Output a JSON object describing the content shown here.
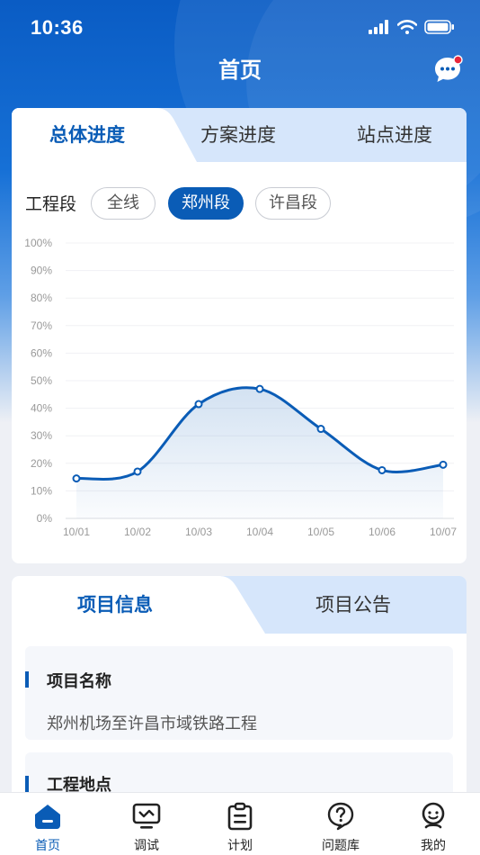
{
  "status_bar": {
    "time": "10:36"
  },
  "nav": {
    "title": "首页",
    "message_icon": "chat-bubble-icon"
  },
  "progress_tabs": [
    {
      "label": "总体进度",
      "active": true
    },
    {
      "label": "方案进度",
      "active": false
    },
    {
      "label": "站点进度",
      "active": false
    }
  ],
  "segment_filter": {
    "label": "工程段",
    "options": [
      {
        "label": "全线",
        "active": false
      },
      {
        "label": "郑州段",
        "active": true
      },
      {
        "label": "许昌段",
        "active": false
      }
    ]
  },
  "chart_data": {
    "type": "line",
    "x": [
      "10/01",
      "10/02",
      "10/03",
      "10/04",
      "10/05",
      "10/06",
      "10/07"
    ],
    "values": [
      14.5,
      17,
      41.5,
      47,
      32.5,
      17.5,
      19.5
    ],
    "yticks": [
      "0%",
      "10%",
      "20%",
      "30%",
      "40%",
      "50%",
      "60%",
      "70%",
      "80%",
      "90%",
      "100%"
    ],
    "ylim": [
      0,
      100
    ],
    "smooth": true,
    "area_fill": true,
    "line_color": "#0a5cb6"
  },
  "info_tabs": [
    {
      "label": "项目信息",
      "active": true
    },
    {
      "label": "项目公告",
      "active": false
    }
  ],
  "project_info": [
    {
      "title": "项目名称",
      "value": "郑州机场至许昌市域铁路工程"
    },
    {
      "title": "工程地点",
      "value": ""
    }
  ],
  "tabbar": [
    {
      "label": "首页",
      "icon": "home-icon",
      "active": true
    },
    {
      "label": "调试",
      "icon": "monitor-icon",
      "active": false
    },
    {
      "label": "计划",
      "icon": "clipboard-icon",
      "active": false
    },
    {
      "label": "问题库",
      "icon": "question-icon",
      "active": false
    },
    {
      "label": "我的",
      "icon": "user-icon",
      "active": false
    }
  ],
  "colors": {
    "primary": "#0a5cb6",
    "tab_bg": "#d6e6fb",
    "badge": "#e8283b"
  }
}
